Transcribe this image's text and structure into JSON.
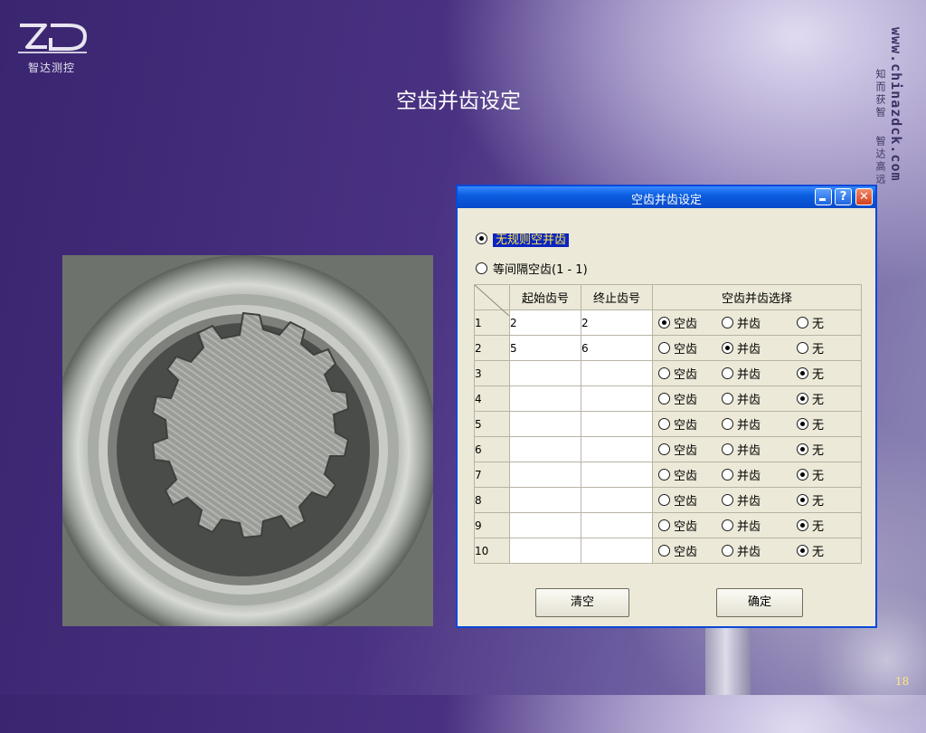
{
  "slide": {
    "title": "空齿并齿设定",
    "logo_text": "智达测控",
    "site_url": "www.chinazdck.com",
    "motto_1": "知而获智",
    "motto_2": "智达高远",
    "page_number": "18"
  },
  "dialog": {
    "title": "空齿并齿设定",
    "mode_options": [
      {
        "label": "无规则空并齿",
        "selected": true
      },
      {
        "label": "等间隔空齿(1 - 1)",
        "selected": false
      }
    ],
    "table": {
      "headers": [
        "起始齿号",
        "终止齿号",
        "空齿并齿选择"
      ],
      "choice_labels": [
        "空齿",
        "并齿",
        "无"
      ],
      "rows": [
        {
          "n": "1",
          "start": "2",
          "end": "2",
          "choice": 0
        },
        {
          "n": "2",
          "start": "5",
          "end": "6",
          "choice": 1
        },
        {
          "n": "3",
          "start": "",
          "end": "",
          "choice": 2
        },
        {
          "n": "4",
          "start": "",
          "end": "",
          "choice": 2
        },
        {
          "n": "5",
          "start": "",
          "end": "",
          "choice": 2
        },
        {
          "n": "6",
          "start": "",
          "end": "",
          "choice": 2
        },
        {
          "n": "7",
          "start": "",
          "end": "",
          "choice": 2
        },
        {
          "n": "8",
          "start": "",
          "end": "",
          "choice": 2
        },
        {
          "n": "9",
          "start": "",
          "end": "",
          "choice": 2
        },
        {
          "n": "10",
          "start": "",
          "end": "",
          "choice": 2
        }
      ]
    },
    "clear_label": "清空",
    "ok_label": "确定"
  },
  "colors": {
    "titlebar": "#0a5ee0",
    "dialog_bg": "#ece9d8",
    "selected_bg": "#0a24c0",
    "selected_fg": "#ffe84a"
  }
}
